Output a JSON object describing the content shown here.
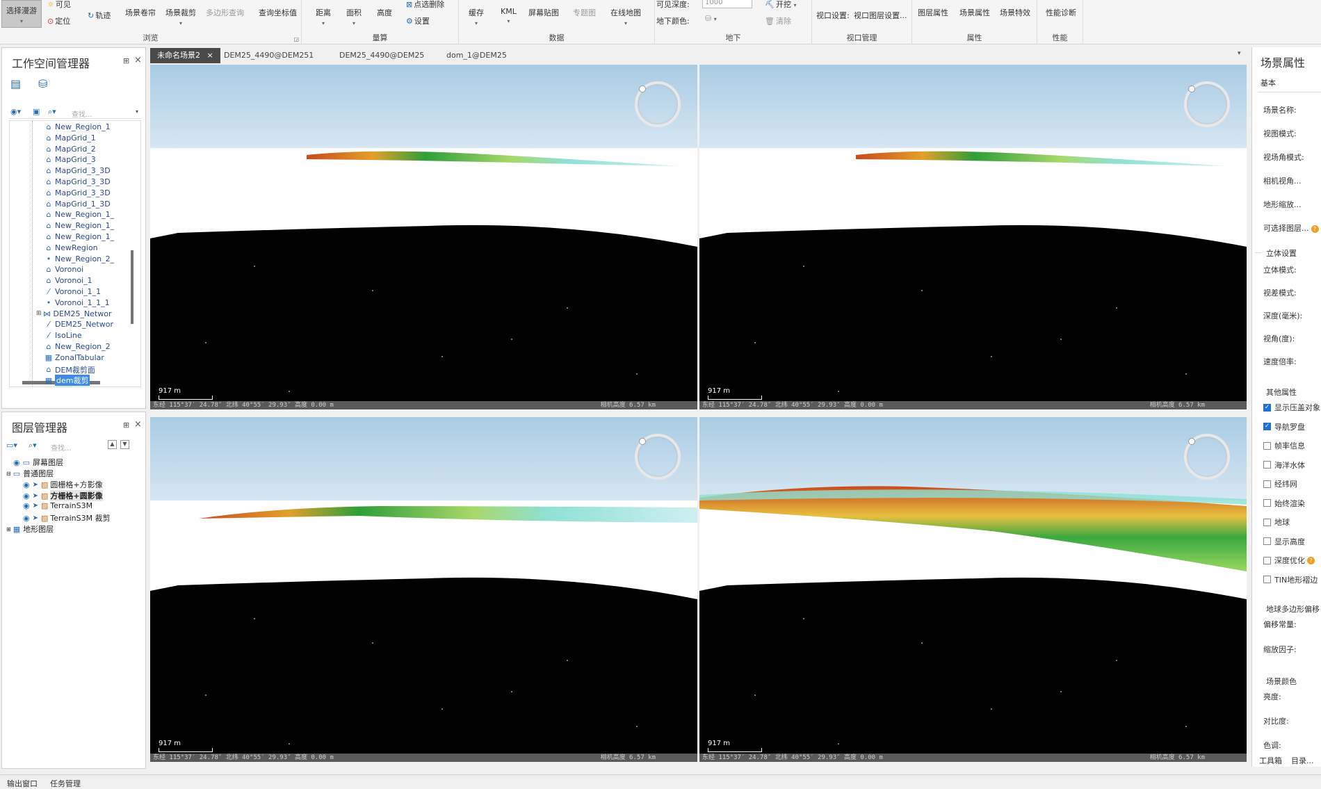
{
  "ribbon": {
    "groups": [
      {
        "name": "浏览",
        "items": {
          "select_roam": "选择漫游",
          "visible": "可见",
          "locate": "定位",
          "track": "轨迹",
          "scene_fly": "场景卷帘",
          "scene_clip": "场景裁剪",
          "polygon_query": "多边形查询",
          "query_coord": "查询坐标值"
        }
      },
      {
        "name": "量算",
        "items": {
          "distance": "距离",
          "area": "面积",
          "height": "高度",
          "point_delete": "点选删除",
          "settings": "设置"
        }
      },
      {
        "name": "数据",
        "items": {
          "cache": "缓存",
          "kml": "KML",
          "screen_map": "屏幕贴图",
          "thematic": "专题图",
          "online_map": "在线地图"
        }
      },
      {
        "name": "地下",
        "items": {
          "visible_depth": "可见深度:",
          "depth_value": "1000",
          "underground_color": "地下颜色:",
          "excavate": "开挖",
          "clear": "清除"
        }
      },
      {
        "name": "视口管理",
        "items": {
          "viewport_settings": "视口设置:",
          "viewport_layer_settings": "视口图层设置..."
        }
      },
      {
        "name": "属性",
        "items": {
          "layer_props": "图层属性",
          "scene_props": "场景属性",
          "scene_effects": "场景特效"
        }
      },
      {
        "name": "性能",
        "items": {
          "perf_diag": "性能诊断"
        }
      }
    ]
  },
  "workspace": {
    "title": "工作空间管理器",
    "search_placeholder": "查找...",
    "items": [
      "New_Region_1",
      "MapGrid_1",
      "MapGrid_2",
      "MapGrid_3",
      "MapGrid_3_3D",
      "MapGrid_3_3D",
      "MapGrid_3_3D",
      "MapGrid_1_3D",
      "New_Region_1_",
      "New_Region_1_",
      "New_Region_1_",
      "NewRegion",
      "New_Region_2_",
      "Voronoi",
      "Voronoi_1",
      "Voronoi_1_1",
      "Voronoi_1_1_1",
      "DEM25_Networ",
      "DEM25_Networ",
      "IsoLine",
      "New_Region_2",
      "ZonalTabular",
      "DEM裁剪面",
      "dem裁剪"
    ],
    "item_icons": [
      "region",
      "region",
      "region",
      "region",
      "region",
      "region",
      "region",
      "region",
      "region",
      "region",
      "region",
      "region",
      "point",
      "region",
      "region",
      "line",
      "point",
      "network",
      "line",
      "line",
      "region",
      "table",
      "region",
      "grid"
    ]
  },
  "layers": {
    "title": "图层管理器",
    "search_placeholder": "查找...",
    "screen_layer": "屏幕图层",
    "normal_layer": "普通图层",
    "items": [
      "圆栅格+方影像",
      "方栅格+圆影像",
      "TerrainS3M",
      "TerrainS3M 裁剪"
    ],
    "terrain_layer": "地形图层"
  },
  "tabs": [
    "未命名场景2",
    "DEM25_4490@DEM251",
    "DEM25_4490@DEM25",
    "dom_1@DEM25"
  ],
  "viewport": {
    "scale": "917 m",
    "status_left": "东经 115°37′ 24.78″   北纬 40°55′ 29.93″   高度 0.00 m",
    "status_right": "相机高度 6.57 km"
  },
  "props": {
    "title": "场景属性",
    "basic": "基本",
    "basic_fields": [
      "场景名称:",
      "视图模式:",
      "视场角模式:",
      "相机视角...",
      "地形缩放...",
      "可选择图层..."
    ],
    "stereo_section": "立体设置",
    "stereo_fields": [
      "立体模式:",
      "视差模式:",
      "深度(毫米):",
      "视角(度):",
      "速度倍率:"
    ],
    "other_section": "其他属性",
    "checkboxes": [
      {
        "label": "显示压盖对象",
        "checked": true
      },
      {
        "label": "导航罗盘",
        "checked": true
      },
      {
        "label": "帧率信息",
        "checked": false
      },
      {
        "label": "海洋水体",
        "checked": false
      },
      {
        "label": "经纬网",
        "checked": false
      },
      {
        "label": "始终渲染",
        "checked": false
      },
      {
        "label": "地球",
        "checked": false
      },
      {
        "label": "显示高度",
        "checked": false
      },
      {
        "label": "深度优化",
        "checked": false
      },
      {
        "label": "TIN地形褶边",
        "checked": false
      }
    ],
    "offset_section": "地球多边形偏移",
    "offset_fields": [
      "偏移常量:",
      "缩放因子:"
    ],
    "color_section": "场景颜色",
    "color_fields": [
      "亮度:",
      "对比度:",
      "色调:"
    ],
    "bottom_tabs": [
      "工具箱",
      "目录..."
    ]
  },
  "bottom": {
    "output": "输出窗口",
    "tasks": "任务管理"
  },
  "colors": {
    "accent": "#1e6fd9",
    "active_tab": "#4a4a4a",
    "terrain_low": "#2e9e3a",
    "terrain_high": "#c84a1c",
    "water": "#8fe0d6"
  }
}
